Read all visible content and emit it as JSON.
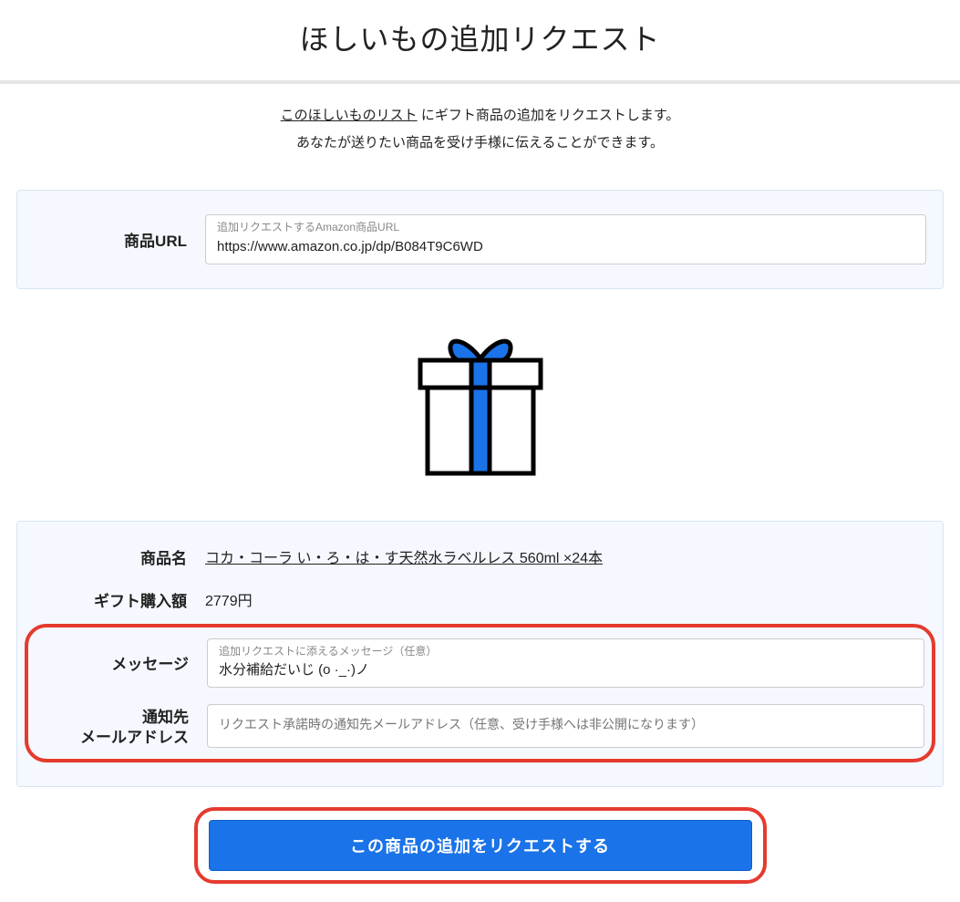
{
  "page": {
    "title": "ほしいもの追加リクエスト"
  },
  "intro": {
    "link_text": "このほしいものリスト",
    "line1_rest": " にギフト商品の追加をリクエストします。",
    "line2": "あなたが送りたい商品を受け手様に伝えることができます。"
  },
  "url_panel": {
    "label": "商品URL",
    "placeholder": "追加リクエストするAmazon商品URL",
    "value": "https://www.amazon.co.jp/dp/B084T9C6WD"
  },
  "details_panel": {
    "product_name_label": "商品名",
    "product_name_value": "コカ・コーラ い・ろ・は・す天然水ラベルレス 560ml ×24本",
    "price_label": "ギフト購入額",
    "price_value": "2779円",
    "message_label": "メッセージ",
    "message_placeholder": "追加リクエストに添えるメッセージ（任意）",
    "message_value": "水分補給だいじ (o ·_·)ノ",
    "email_label_line1": "通知先",
    "email_label_line2": "メールアドレス",
    "email_placeholder": "リクエスト承諾時の通知先メールアドレス（任意、受け手様へは非公開になります）",
    "email_value": ""
  },
  "submit": {
    "label": "この商品の追加をリクエストする"
  }
}
